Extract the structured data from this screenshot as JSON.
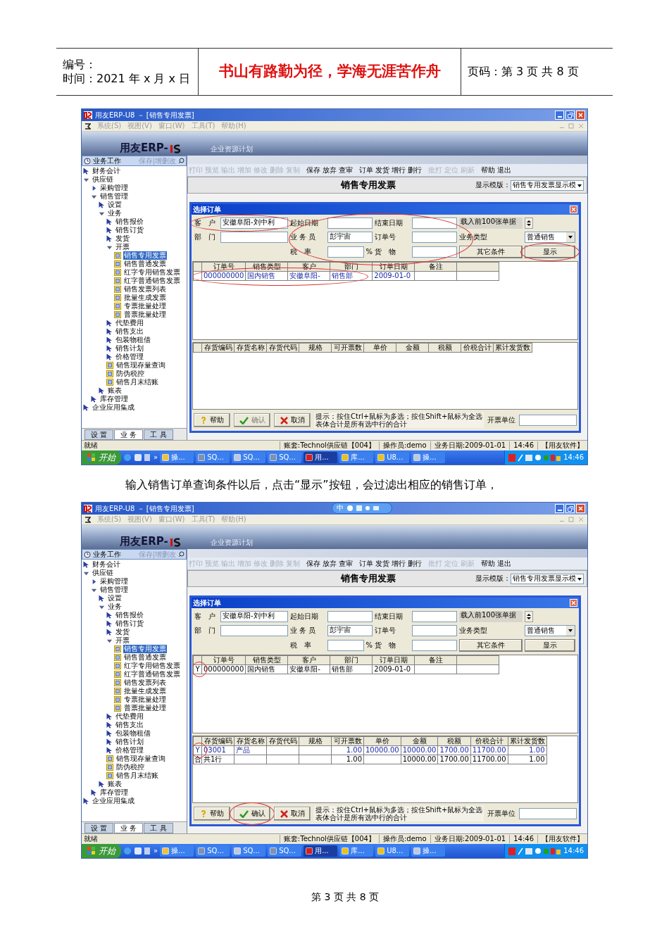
{
  "header": {
    "number_label": "编号：",
    "time_label": "时间：2021 年 x 月 x 日",
    "motto": "书山有路勤为径，学海无涯苦作舟",
    "page_label": "页码：第 3 页  共 8 页"
  },
  "screenshots": [
    {
      "title": "用友ERP-U8 － [销售专用发票]",
      "menus": [
        {
          "label": "系统(S)",
          "disabled": true
        },
        {
          "label": "视图(V)",
          "disabled": true
        },
        {
          "label": "窗口(W)",
          "disabled": true
        },
        {
          "label": "工具(T)",
          "disabled": true
        },
        {
          "label": "帮助(H)",
          "disabled": true
        }
      ],
      "brand": "用友ERP-",
      "subtitle": "企业资源计划",
      "panel": {
        "title": "业务工作",
        "links": "保存|增删改"
      },
      "tree": [
        {
          "label": "财务会计",
          "kind": "link",
          "selected": false
        },
        {
          "label": "供应链",
          "kind": "group",
          "expanded": true,
          "selected": false,
          "children": [
            {
              "label": "采购管理",
              "kind": "group",
              "expanded": false,
              "selected": false
            },
            {
              "label": "销售管理",
              "kind": "group",
              "expanded": true,
              "selected": false,
              "children": [
                {
                  "label": "设置",
                  "kind": "link",
                  "selected": false
                },
                {
                  "label": "业务",
                  "kind": "group",
                  "expanded": true,
                  "selected": false,
                  "children": [
                    {
                      "label": "销售报价",
                      "kind": "link",
                      "selected": false
                    },
                    {
                      "label": "销售订货",
                      "kind": "link",
                      "selected": false
                    },
                    {
                      "label": "发货",
                      "kind": "link",
                      "selected": false
                    },
                    {
                      "label": "开票",
                      "kind": "group",
                      "expanded": true,
                      "selected": false,
                      "children": [
                        {
                          "label": "销售专用发票",
                          "kind": "form",
                          "selected": true
                        },
                        {
                          "label": "销售普通发票",
                          "kind": "form",
                          "selected": false
                        },
                        {
                          "label": "红字专用销售发票",
                          "kind": "form",
                          "selected": false
                        },
                        {
                          "label": "红字普通销售发票",
                          "kind": "form",
                          "selected": false
                        },
                        {
                          "label": "销售发票列表",
                          "kind": "form",
                          "selected": false
                        },
                        {
                          "label": "批量生成发票",
                          "kind": "form",
                          "selected": false
                        },
                        {
                          "label": "专票批量处理",
                          "kind": "form",
                          "selected": false
                        },
                        {
                          "label": "普票批量处理",
                          "kind": "form",
                          "selected": false
                        }
                      ]
                    },
                    {
                      "label": "代垫费用",
                      "kind": "link",
                      "selected": false
                    },
                    {
                      "label": "销售支出",
                      "kind": "link",
                      "selected": false
                    },
                    {
                      "label": "包装物租借",
                      "kind": "link",
                      "selected": false
                    },
                    {
                      "label": "销售计划",
                      "kind": "link",
                      "selected": false
                    },
                    {
                      "label": "价格管理",
                      "kind": "link",
                      "selected": false
                    },
                    {
                      "label": "销售现存量查询",
                      "kind": "form",
                      "selected": false
                    },
                    {
                      "label": "防伪税控",
                      "kind": "form",
                      "selected": false
                    },
                    {
                      "label": "销售月末结账",
                      "kind": "form",
                      "selected": false
                    }
                  ]
                },
                {
                  "label": "账表",
                  "kind": "link",
                  "selected": false
                }
              ]
            },
            {
              "label": "库存管理",
              "kind": "link",
              "selected": false
            }
          ]
        },
        {
          "label": "企业应用集成",
          "kind": "link",
          "selected": false
        }
      ],
      "panel_tabs": [
        {
          "label": "设 置",
          "selected": false
        },
        {
          "label": "业 务",
          "selected": true
        },
        {
          "label": "工 具",
          "selected": false
        }
      ],
      "toolbar": [
        {
          "items": [
            {
              "label": "打印",
              "disabled": true
            },
            {
              "label": "预览",
              "disabled": true
            },
            {
              "label": "输出",
              "disabled": true
            },
            {
              "label": "增加",
              "disabled": true
            },
            {
              "label": "修改",
              "disabled": true
            },
            {
              "label": "删除",
              "disabled": true
            },
            {
              "label": "复制",
              "disabled": true
            }
          ]
        },
        {
          "items": [
            {
              "label": "保存",
              "disabled": false
            },
            {
              "label": "放弃",
              "disabled": false
            },
            {
              "label": "查审",
              "disabled": false
            }
          ]
        },
        {
          "items": [
            {
              "label": "订单",
              "disabled": false
            },
            {
              "label": "发货",
              "disabled": false
            },
            {
              "label": "增行",
              "disabled": false
            },
            {
              "label": "删行",
              "disabled": false
            }
          ]
        },
        {
          "items": [
            {
              "label": "批打",
              "disabled": true
            },
            {
              "label": "定位",
              "disabled": true
            },
            {
              "label": "刷新",
              "disabled": true
            }
          ]
        },
        {
          "items": [
            {
              "label": "帮助",
              "disabled": false
            },
            {
              "label": "退出",
              "disabled": false
            }
          ]
        }
      ],
      "document": {
        "title": "销售专用发票",
        "template_label": "显示模版：",
        "template_value": "销售专用发票显示模"
      },
      "dialog": {
        "title": "选择订单",
        "filters_circled": true,
        "rows": [
          {
            "items": [
              {
                "kind": "field",
                "label": "客　户",
                "value": "安徽阜阳-刘中利",
                "circled": true
              },
              {
                "kind": "field",
                "label": "起始日期"
              },
              {
                "kind": "field",
                "label": "结束日期"
              },
              {
                "kind": "counter",
                "label": "载入前100张单据"
              }
            ]
          },
          {
            "items": [
              {
                "kind": "field",
                "label": "部　门"
              },
              {
                "kind": "field",
                "label": "业 务 员",
                "value": "彭宇宙"
              },
              {
                "kind": "field",
                "label": "订单号"
              },
              {
                "kind": "select",
                "label": "业务类型",
                "value": "普通销售"
              }
            ]
          },
          {
            "items": [
              {
                "kind": "field",
                "label": "税　率",
                "suffix": "%"
              },
              {
                "kind": "field",
                "label": "货　物"
              },
              {
                "kind": "button",
                "label": "其它条件"
              },
              {
                "kind": "button",
                "label": "显示",
                "circled": true
              }
            ]
          }
        ],
        "orders": {
          "columns": [
            "订单号",
            "销售类型",
            "客户",
            "部门",
            "订单日期",
            "备注"
          ],
          "rows": [
            {
              "highlighted": true,
              "circled": true,
              "cells": [
                "000000000",
                "国内销售",
                "安徽阜阳-",
                "销售部",
                "2009-01-0",
                null
              ]
            }
          ]
        },
        "items": {
          "columns": [
            "存货编码",
            "存货名称",
            "存货代码",
            "规格",
            "可开票数",
            "单价",
            "金额",
            "税额",
            "价税合计",
            "累计发货数"
          ]
        },
        "buttons": [
          {
            "kind": "help",
            "label": "帮助",
            "disabled": false
          },
          {
            "kind": "confirm",
            "label": "确认",
            "disabled": true
          },
          {
            "kind": "cancel",
            "label": "取消",
            "disabled": false
          }
        ],
        "hint": [
          "提示：按住Ctrl+鼠标为多选；按住Shift+鼠标为全选",
          "表体合计是所有选中行的合计"
        ],
        "unit_label": "开票单位"
      },
      "status": [
        "就绪",
        "账套:Technol供应链【004】",
        "操作员:demo",
        "业务日期:2009-01-01",
        "14:46",
        "【用友软件】"
      ],
      "taskbar": {
        "start": "开始",
        "more": "»",
        "items": [
          {
            "label": "操...",
            "active": false
          },
          {
            "label": "SQ...",
            "active": false
          },
          {
            "label": "SQ...",
            "active": false
          },
          {
            "label": "SQ...",
            "active": false
          },
          {
            "label": "用...",
            "active": true
          },
          {
            "label": "库...",
            "active": false
          },
          {
            "label": "U8...",
            "active": false
          },
          {
            "label": "操...",
            "active": false
          }
        ],
        "time": "14:46"
      }
    },
    {
      "title": "用友ERP-U8 － [销售专用发票]",
      "ime_bar": {
        "label": "中"
      },
      "menus": [
        {
          "label": "系统(S)",
          "disabled": true
        },
        {
          "label": "视图(V)",
          "disabled": true
        },
        {
          "label": "窗口(W)",
          "disabled": true
        },
        {
          "label": "工具(T)",
          "disabled": true
        },
        {
          "label": "帮助(H)",
          "disabled": true
        }
      ],
      "brand": "用友ERP-",
      "subtitle": "企业资源计划",
      "panel": {
        "title": "业务工作",
        "links": "保存|增删改"
      },
      "tree": [
        {
          "label": "财务会计",
          "kind": "link",
          "selected": false
        },
        {
          "label": "供应链",
          "kind": "group",
          "expanded": true,
          "selected": false,
          "children": [
            {
              "label": "采购管理",
              "kind": "group",
              "expanded": false,
              "selected": false
            },
            {
              "label": "销售管理",
              "kind": "group",
              "expanded": true,
              "selected": false,
              "children": [
                {
                  "label": "设置",
                  "kind": "link",
                  "selected": false
                },
                {
                  "label": "业务",
                  "kind": "group",
                  "expanded": true,
                  "selected": false,
                  "children": [
                    {
                      "label": "销售报价",
                      "kind": "link",
                      "selected": false
                    },
                    {
                      "label": "销售订货",
                      "kind": "link",
                      "selected": false
                    },
                    {
                      "label": "发货",
                      "kind": "link",
                      "selected": false
                    },
                    {
                      "label": "开票",
                      "kind": "group",
                      "expanded": true,
                      "selected": false,
                      "children": [
                        {
                          "label": "销售专用发票",
                          "kind": "form",
                          "selected": true
                        },
                        {
                          "label": "销售普通发票",
                          "kind": "form",
                          "selected": false
                        },
                        {
                          "label": "红字专用销售发票",
                          "kind": "form",
                          "selected": false
                        },
                        {
                          "label": "红字普通销售发票",
                          "kind": "form",
                          "selected": false
                        },
                        {
                          "label": "销售发票列表",
                          "kind": "form",
                          "selected": false
                        },
                        {
                          "label": "批量生成发票",
                          "kind": "form",
                          "selected": false
                        },
                        {
                          "label": "专票批量处理",
                          "kind": "form",
                          "selected": false
                        },
                        {
                          "label": "普票批量处理",
                          "kind": "form",
                          "selected": false
                        }
                      ]
                    },
                    {
                      "label": "代垫费用",
                      "kind": "link",
                      "selected": false
                    },
                    {
                      "label": "销售支出",
                      "kind": "link",
                      "selected": false
                    },
                    {
                      "label": "包装物租借",
                      "kind": "link",
                      "selected": false
                    },
                    {
                      "label": "销售计划",
                      "kind": "link",
                      "selected": false
                    },
                    {
                      "label": "价格管理",
                      "kind": "link",
                      "selected": false
                    },
                    {
                      "label": "销售现存量查询",
                      "kind": "form",
                      "selected": false
                    },
                    {
                      "label": "防伪税控",
                      "kind": "form",
                      "selected": false
                    },
                    {
                      "label": "销售月末结账",
                      "kind": "form",
                      "selected": false
                    }
                  ]
                },
                {
                  "label": "账表",
                  "kind": "link",
                  "selected": false
                }
              ]
            },
            {
              "label": "库存管理",
              "kind": "link",
              "selected": false
            }
          ]
        },
        {
          "label": "企业应用集成",
          "kind": "link",
          "selected": false
        }
      ],
      "panel_tabs": [
        {
          "label": "设 置",
          "selected": false
        },
        {
          "label": "业 务",
          "selected": true
        },
        {
          "label": "工 具",
          "selected": false
        }
      ],
      "toolbar": [
        {
          "items": [
            {
              "label": "打印",
              "disabled": true
            },
            {
              "label": "预览",
              "disabled": true
            },
            {
              "label": "输出",
              "disabled": true
            },
            {
              "label": "增加",
              "disabled": true
            },
            {
              "label": "修改",
              "disabled": true
            },
            {
              "label": "删除",
              "disabled": true
            },
            {
              "label": "复制",
              "disabled": true
            }
          ]
        },
        {
          "items": [
            {
              "label": "保存",
              "disabled": false
            },
            {
              "label": "放弃",
              "disabled": false
            },
            {
              "label": "查审",
              "disabled": false
            }
          ]
        },
        {
          "items": [
            {
              "label": "订单",
              "disabled": false
            },
            {
              "label": "发货",
              "disabled": false
            },
            {
              "label": "增行",
              "disabled": false
            },
            {
              "label": "删行",
              "disabled": false
            }
          ]
        },
        {
          "items": [
            {
              "label": "批打",
              "disabled": true
            },
            {
              "label": "定位",
              "disabled": true
            },
            {
              "label": "刷新",
              "disabled": true
            }
          ]
        },
        {
          "items": [
            {
              "label": "帮助",
              "disabled": false
            },
            {
              "label": "退出",
              "disabled": false
            }
          ]
        }
      ],
      "document": {
        "title": "销售专用发票",
        "template_label": "显示模版：",
        "template_value": "销售专用发票显示模"
      },
      "dialog": {
        "title": "选择订单",
        "rows": [
          {
            "items": [
              {
                "kind": "field",
                "label": "客　户",
                "value": "安徽阜阳-刘中利"
              },
              {
                "kind": "field",
                "label": "起始日期"
              },
              {
                "kind": "field",
                "label": "结束日期"
              },
              {
                "kind": "counter",
                "label": "载入前100张单据"
              }
            ]
          },
          {
            "items": [
              {
                "kind": "field",
                "label": "部　门"
              },
              {
                "kind": "field",
                "label": "业 务 员",
                "value": "彭宇宙"
              },
              {
                "kind": "field",
                "label": "订单号"
              },
              {
                "kind": "select",
                "label": "业务类型",
                "value": "普通销售"
              }
            ]
          },
          {
            "items": [
              {
                "kind": "field",
                "label": "税　率",
                "suffix": "%"
              },
              {
                "kind": "field",
                "label": "货　物"
              },
              {
                "kind": "button",
                "label": "其它条件"
              },
              {
                "kind": "button",
                "label": "显示"
              }
            ]
          }
        ],
        "orders": {
          "columns": [
            "订单号",
            "销售类型",
            "客户",
            "部门",
            "订单日期",
            "备注"
          ],
          "rows": [
            {
              "flag": "Y",
              "highlighted": false,
              "flag_circled": true,
              "cells": [
                "000000000",
                "国内销售",
                "安徽阜阳-",
                "销售部",
                "2009-01-0",
                null
              ]
            }
          ]
        },
        "items": {
          "columns": [
            "存货编码",
            "存货名称",
            "存货代码",
            "规格",
            "可开票数",
            "单价",
            "金额",
            "税额",
            "价税合计",
            "累计发货数"
          ],
          "rows": [
            {
              "flag": "Y",
              "highlighted": true,
              "flag_circled": true,
              "cells": [
                "03001",
                "产品",
                null,
                null,
                "1.00",
                "10000.00",
                "10000.00",
                "1700.00",
                "11700.00",
                "1.00"
              ]
            },
            {
              "flag": "合",
              "highlighted": false,
              "cells": [
                "共1行",
                null,
                null,
                null,
                "1.00",
                null,
                "10000.00",
                "1700.00",
                "11700.00",
                "1.00"
              ]
            }
          ]
        },
        "buttons": [
          {
            "kind": "help",
            "label": "帮助",
            "disabled": false
          },
          {
            "kind": "confirm",
            "label": "确认",
            "disabled": false,
            "circled": true
          },
          {
            "kind": "cancel",
            "label": "取消",
            "disabled": false
          }
        ],
        "hint": [
          "提示：按住Ctrl+鼠标为多选；按住Shift+鼠标为全选",
          "表体合计是所有选中行的合计"
        ],
        "unit_label": "开票单位"
      },
      "status": [
        "就绪",
        "账套:Technol供应链【004】",
        "操作员:demo",
        "业务日期:2009-01-01",
        "14:46",
        "【用友软件】"
      ],
      "taskbar": {
        "start": "开始",
        "more": "»",
        "items": [
          {
            "label": "操...",
            "active": false
          },
          {
            "label": "SQ...",
            "active": false
          },
          {
            "label": "SQ...",
            "active": false
          },
          {
            "label": "SQ...",
            "active": false
          },
          {
            "label": "用...",
            "active": true
          },
          {
            "label": "库...",
            "active": false
          },
          {
            "label": "U8...",
            "active": false
          },
          {
            "label": "操...",
            "active": false
          }
        ],
        "time": "14:46"
      }
    }
  ],
  "caption": "输入销售订单查询条件以后，点击“显示”按钮，会过滤出相应的销售订单，",
  "footer": "第 3 页 共 8 页"
}
